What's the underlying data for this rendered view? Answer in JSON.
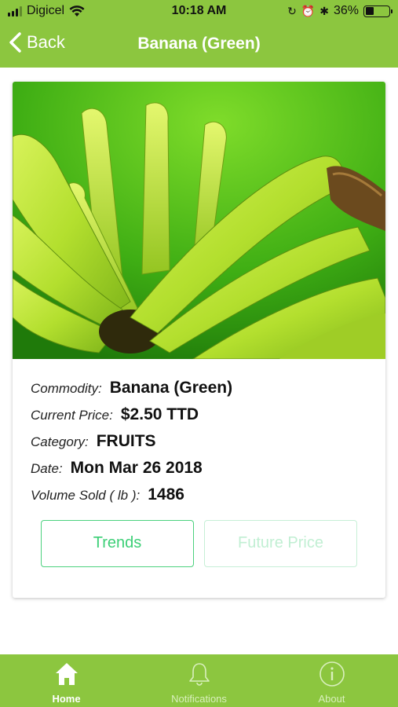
{
  "status_bar": {
    "carrier": "Digicel",
    "time": "10:18 AM",
    "battery": "36%",
    "battery_level": 0.36
  },
  "nav": {
    "back_label": "Back",
    "title": "Banana (Green)"
  },
  "details": {
    "commodity_label": "Commodity",
    "commodity_value": "Banana (Green)",
    "price_label": "Current Price",
    "price_value": "$2.50 TTD",
    "category_label": "Category",
    "category_value": "FRUITS",
    "date_label": "Date",
    "date_value": "Mon Mar 26 2018",
    "volume_label": "Volume Sold ( lb )",
    "volume_value": "1486",
    "separator": ":"
  },
  "buttons": {
    "trends": "Trends",
    "future_price": "Future Price"
  },
  "tabs": [
    {
      "label": "Home",
      "icon": "home-icon",
      "active": true
    },
    {
      "label": "Notifications",
      "icon": "bell-icon",
      "active": false
    },
    {
      "label": "About",
      "icon": "info-icon",
      "active": false
    }
  ],
  "colors": {
    "brand_green": "#8cc63f",
    "button_green": "#3ccf76"
  }
}
